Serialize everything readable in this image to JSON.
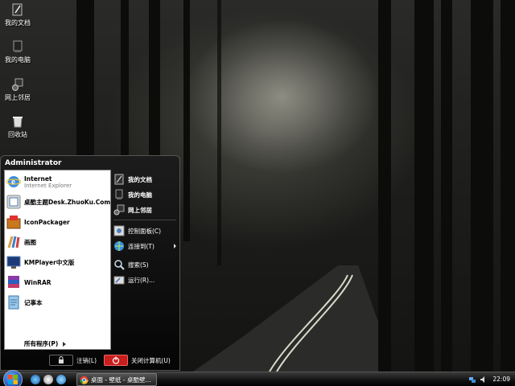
{
  "desktop": {
    "icons": [
      {
        "label": "我的文档",
        "icon": "my-documents-icon"
      },
      {
        "label": "我的电脑",
        "icon": "my-computer-icon"
      },
      {
        "label": "网上邻居",
        "icon": "network-places-icon"
      },
      {
        "label": "回收站",
        "icon": "recycle-bin-icon"
      }
    ]
  },
  "start_menu": {
    "user": "Administrator",
    "pinned": [
      {
        "title": "Internet",
        "subtitle": "Internet Explorer",
        "icon": "internet-explorer-icon"
      },
      {
        "title": "桌酷主题Desk.ZhuoKu.Com",
        "icon": "zhuoku-theme-icon"
      },
      {
        "title": "IconPackager",
        "icon": "iconpackager-icon"
      },
      {
        "title": "画图",
        "icon": "paint-icon"
      },
      {
        "title": "KMPlayer中文版",
        "icon": "kmplayer-icon"
      },
      {
        "title": "WinRAR",
        "icon": "winrar-icon"
      },
      {
        "title": "记事本",
        "icon": "notepad-icon"
      }
    ],
    "all_programs": "所有程序(P)",
    "right": [
      {
        "label": "我的文档",
        "icon": "my-documents-icon"
      },
      {
        "label": "我的电脑",
        "icon": "my-computer-icon"
      },
      {
        "label": "网上邻居",
        "icon": "network-places-icon"
      },
      {
        "label": "控制面板(C)",
        "icon": "control-panel-icon"
      },
      {
        "label": "连接到(T)",
        "icon": "connect-to-icon"
      },
      {
        "label": "搜索(S)",
        "icon": "search-icon"
      },
      {
        "label": "运行(R)...",
        "icon": "run-icon"
      }
    ],
    "logoff": "注销(L)",
    "shutdown": "关闭计算机(U)"
  },
  "taskbar": {
    "task_button": "桌面 - 壁纸 - 桌酷壁...",
    "clock": "22:09"
  },
  "colors": {
    "start_menu_bg": "#0a0a0a",
    "start_orb": "#1f58b8",
    "shutdown_red": "#c81e1e"
  }
}
